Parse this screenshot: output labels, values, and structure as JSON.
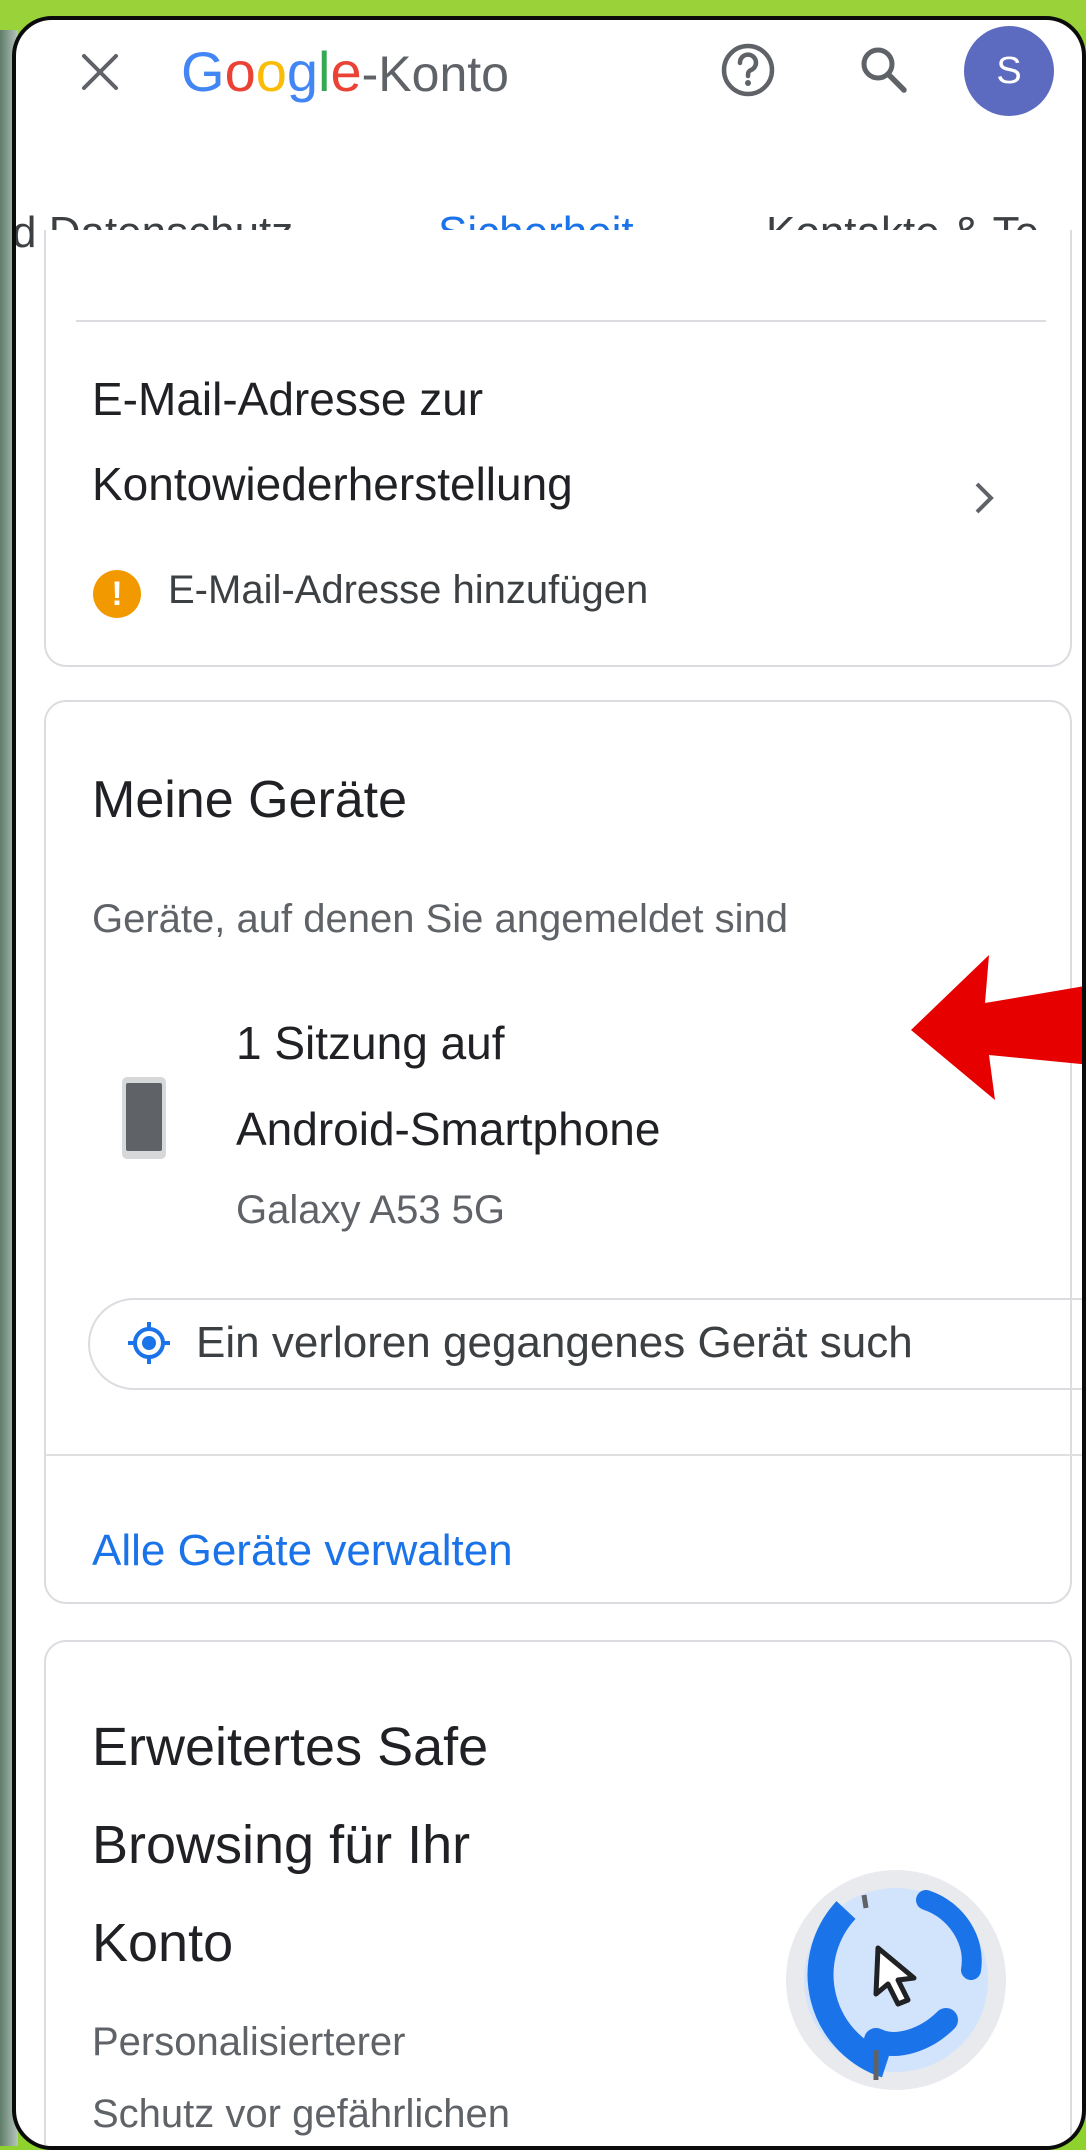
{
  "header": {
    "logo_g": "G",
    "logo_o1": "o",
    "logo_o2": "o",
    "logo_g2": "g",
    "logo_l": "l",
    "logo_e": "e",
    "logo_suffix": "-Konto",
    "avatar_letter": "S",
    "close_icon": "close-icon",
    "help_icon": "help-icon",
    "search_icon": "search-icon"
  },
  "tabs": [
    {
      "label": "d Datenschutz"
    },
    {
      "label": "Sicherheit",
      "active": true
    },
    {
      "label": "Kontakte & Te"
    }
  ],
  "recovery_email": {
    "title_line1": "E-Mail-Adresse zur",
    "title_line2": "Kontowiederherstellung",
    "warning": "E-Mail-Adresse hinzufügen"
  },
  "devices": {
    "title": "Meine Geräte",
    "subtitle": "Geräte, auf denen Sie angemeldet sind",
    "session_line1": "1 Sitzung auf",
    "session_line2": "Android-Smartphone",
    "device_model": "Galaxy A53 5G",
    "find_device_chip": "Ein verloren gegangenes Gerät such",
    "manage_link": "Alle Geräte verwalten"
  },
  "safe_browsing": {
    "title_line1": "Erweitertes Safe",
    "title_line2": "Browsing für Ihr",
    "title_line3": "Konto",
    "desc_line1": "Personalisierterer",
    "desc_line2": "Schutz vor gefährlichen"
  },
  "colors": {
    "accent": "#1a73e8",
    "warning": "#f29900",
    "avatar": "#5c6bc0",
    "annotation_arrow": "#e60000",
    "frame_background": "#8fd12e"
  }
}
